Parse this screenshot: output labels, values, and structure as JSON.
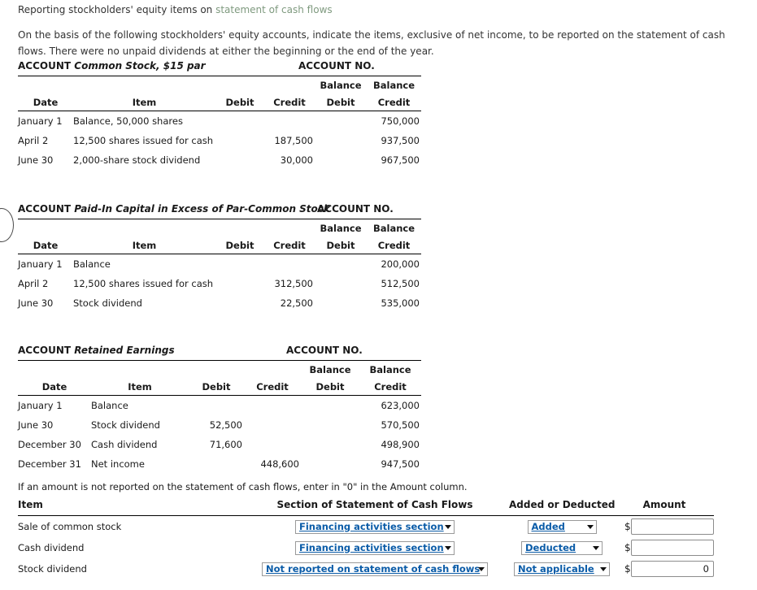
{
  "intro": {
    "title_prefix": "Reporting stockholders' equity items on ",
    "title_link": "statement of cash flows",
    "body": "On the basis of the following stockholders' equity accounts, indicate the items, exclusive of net income, to be reported on the statement of cash flows. There were no unpaid dividends at either the beginning or the end of the year."
  },
  "ledger_headers": {
    "date": "Date",
    "item": "Item",
    "debit": "Debit",
    "credit": "Credit",
    "balance": "Balance",
    "balance_debit": "Debit",
    "balance_credit": "Credit",
    "account_label": "ACCOUNT",
    "account_no_label": "ACCOUNT NO."
  },
  "accounts": [
    {
      "name": "Common Stock, $15 par",
      "rows": [
        {
          "date": "January 1",
          "item": "Balance, 50,000 shares",
          "debit": "",
          "credit": "",
          "bal_debit": "",
          "bal_credit": "750,000"
        },
        {
          "date": "April 2",
          "item": "12,500 shares issued for cash",
          "debit": "",
          "credit": "187,500",
          "bal_debit": "",
          "bal_credit": "937,500"
        },
        {
          "date": "June 30",
          "item": "2,000-share stock dividend",
          "debit": "",
          "credit": "30,000",
          "bal_debit": "",
          "bal_credit": "967,500"
        }
      ]
    },
    {
      "name": "Paid-In Capital in Excess of Par-Common Stock",
      "rows": [
        {
          "date": "January 1",
          "item": "Balance",
          "debit": "",
          "credit": "",
          "bal_debit": "",
          "bal_credit": "200,000"
        },
        {
          "date": "April 2",
          "item": "12,500 shares issued for cash",
          "debit": "",
          "credit": "312,500",
          "bal_debit": "",
          "bal_credit": "512,500"
        },
        {
          "date": "June 30",
          "item": "Stock dividend",
          "debit": "",
          "credit": "22,500",
          "bal_debit": "",
          "bal_credit": "535,000"
        }
      ]
    },
    {
      "name": "Retained Earnings",
      "rows": [
        {
          "date": "January 1",
          "item": "Balance",
          "debit": "",
          "credit": "",
          "bal_debit": "",
          "bal_credit": "623,000"
        },
        {
          "date": "June 30",
          "item": "Stock dividend",
          "debit": "52,500",
          "credit": "",
          "bal_debit": "",
          "bal_credit": "570,500"
        },
        {
          "date": "December 30",
          "item": "Cash dividend",
          "debit": "71,600",
          "credit": "",
          "bal_debit": "",
          "bal_credit": "498,900"
        },
        {
          "date": "December 31",
          "item": "Net income",
          "debit": "",
          "credit": "448,600",
          "bal_debit": "",
          "bal_credit": "947,500"
        }
      ]
    }
  ],
  "form": {
    "note": "If an amount is not reported on the statement of cash flows, enter in \"0\" in the Amount column.",
    "headers": {
      "item": "Item",
      "section": "Section of Statement of Cash Flows",
      "added_or_deducted": "Added or Deducted",
      "amount": "Amount"
    },
    "currency_symbol": "$",
    "link_color": "#0b5ca8",
    "rows": [
      {
        "item": "Sale of common stock",
        "section": "Financing activities section",
        "added_or_deducted": "Added",
        "amount": "",
        "amount_placeholder": ""
      },
      {
        "item": "Cash dividend",
        "section": "Financing activities section",
        "added_or_deducted": "Deducted",
        "amount": "",
        "amount_placeholder": ""
      },
      {
        "item": "Stock dividend",
        "section": "Not reported on statement of cash flows",
        "added_or_deducted": "Not applicable",
        "amount": "0",
        "amount_placeholder": ""
      }
    ]
  }
}
